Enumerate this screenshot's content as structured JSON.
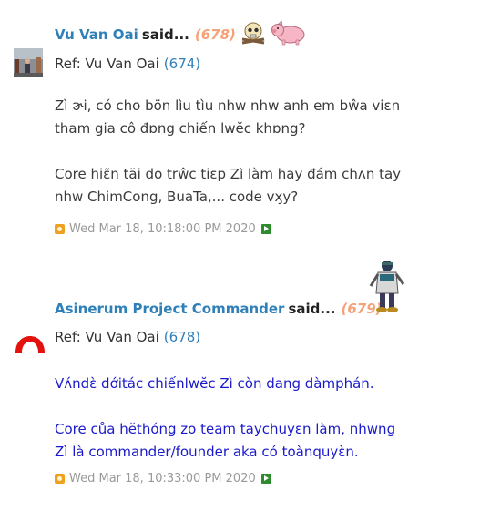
{
  "posts": [
    {
      "author": "Vu Van Oai",
      "said": "said...",
      "number": "(678)",
      "emoticons": [
        "skull-crossbones-icon",
        "pig-icon"
      ],
      "ref_label": "Ref: Vu Van Oai",
      "ref_number": "(674)",
      "lines": [
        "Zì ɚi, có cho bön lìu tìu nhw nhw anh em bŵa viɛn",
        "tham gia cô đɒng chiến lwĕc khɒng?",
        "",
        "Core hiɛ̃n täi do trŵc tiɛp Zì làm hay đám chʌn tay",
        "nhw ChimCong, BuaTa,... code vӽy?"
      ],
      "timestamp": "Wed Mar 18, 10:18:00 PM 2020"
    },
    {
      "author": "Asinerum Project Commander",
      "said": "said...",
      "number": "(679)",
      "emoticons": [
        "standing-figure-icon"
      ],
      "ref_label": "Ref: Vu Van Oai",
      "ref_number": "(678)",
      "lines": [
        "Vʌ́ndɛ̀ dớitác chiếnlwĕc Zì còn dang dàmphán.",
        "",
        "Core cůa hĕthóng zo team taychuyɛn làm, nhwng",
        "Zì là commander/founder aka có toànquyɛ̀n."
      ],
      "timestamp": "Wed Mar 18, 10:33:00 PM 2020"
    }
  ],
  "colors": {
    "author": "#2f7fb8",
    "number": "#f4a27a",
    "body2": "#1a1acc",
    "timestamp": "#999999"
  }
}
